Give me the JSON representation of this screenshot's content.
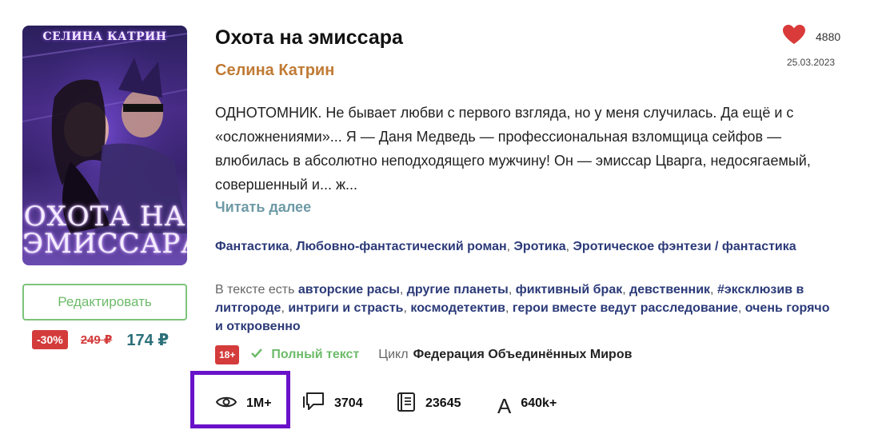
{
  "book": {
    "title": "Охота на эмиссара",
    "author": "Селина Катрин",
    "likes": "4880",
    "date": "25.03.2023",
    "description": "ОДНОТОМНИК. Не бывает любви с первого взгляда, но у меня случилась. Да ещё и с «осложнениями»... Я — Даня Медведь — профессиональная взломщица сейфов — влюбилась в абсолютно неподходящего мужчину! Он — эмиссар Цварга, недосягаемый, совершенный и... ж...",
    "read_more": "Читать далее"
  },
  "cover": {
    "author_text": "СЕЛИНА КАТРИН",
    "title_line1": "ОХОТА НА",
    "title_line2": "ЭМИССАРА"
  },
  "purchase": {
    "edit_label": "Редактировать",
    "discount": "-30%",
    "old_price": "249 ₽",
    "new_price": "174 ₽"
  },
  "genres": [
    "Фантастика",
    "Любовно-фантастический роман",
    "Эротика",
    "Эротическое фэнтези / фантастика"
  ],
  "tags": {
    "intro": "В тексте есть",
    "items": [
      "авторские расы",
      "другие планеты",
      "фиктивный брак",
      "девственник",
      "#эксклюзив в литгороде",
      "интриги и страсть",
      "космодетектив",
      "герои вместе ведут расследование",
      "очень горячо и откровенно"
    ]
  },
  "status": {
    "age": "18+",
    "full_text": "Полный текст",
    "series_label": "Цикл",
    "series_name": "Федерация Объединённых Миров"
  },
  "stats": {
    "views": "1M+",
    "comments": "3704",
    "pages": "23645",
    "chars_glyph": "A",
    "chars": "640k+"
  },
  "colors": {
    "accent_green": "#6dbb6a",
    "price_red": "#d43b3b",
    "author_orange": "#c07b35",
    "link_blue": "#2b3a78",
    "highlight_purple": "#6a12c9"
  },
  "icons": [
    "heart-icon",
    "check-icon",
    "eye-icon",
    "comment-icon",
    "book-pages-icon"
  ]
}
